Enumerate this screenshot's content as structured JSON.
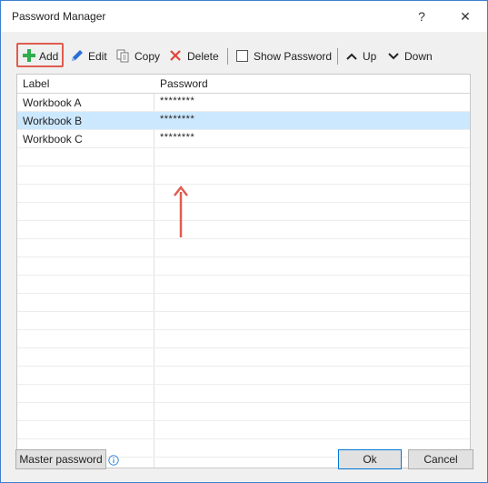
{
  "window": {
    "title": "Password Manager",
    "help_glyph": "?",
    "close_glyph": "✕"
  },
  "toolbar": {
    "add_label": "Add",
    "edit_label": "Edit",
    "copy_label": "Copy",
    "delete_label": "Delete",
    "show_password_label": "Show Password",
    "show_password_checked": false,
    "up_label": "Up",
    "down_label": "Down"
  },
  "grid": {
    "columns": [
      "Label",
      "Password"
    ],
    "rows": [
      {
        "label": "Workbook A",
        "password": "********",
        "selected": false
      },
      {
        "label": "Workbook B",
        "password": "********",
        "selected": true
      },
      {
        "label": "Workbook C",
        "password": "********",
        "selected": false
      }
    ]
  },
  "footer": {
    "master_password_label": "Master password",
    "ok_label": "Ok",
    "cancel_label": "Cancel"
  },
  "colors": {
    "accent": "#0078d7",
    "annotation": "#e05c4f",
    "selection": "#cce8ff",
    "add_icon": "#2eae4d",
    "delete_icon": "#e0443a",
    "edit_icon": "#2a6fd6"
  }
}
